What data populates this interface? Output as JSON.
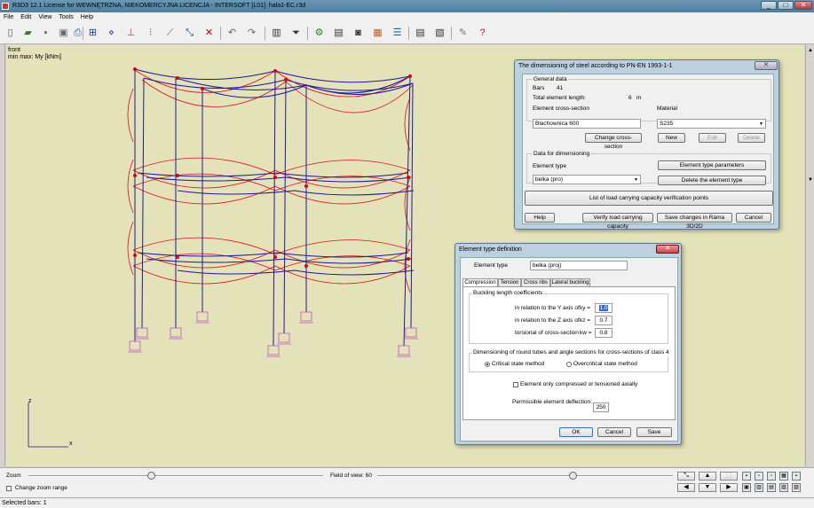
{
  "window": {
    "title": "R3D3 12.1 License for WEWNĘTRZNA, NIEKOMERCYJNA LICENCJA - INTERSOFT [L01]: hala1-EC.r3d",
    "minimize": "_",
    "maximize": "□",
    "close": "✕"
  },
  "menu": [
    "File",
    "Edit",
    "View",
    "Tools",
    "Help"
  ],
  "toolbar_icons": [
    "new-file-icon",
    "open-folder-icon",
    "save-icon",
    "save-as-icon",
    "print-preview-icon",
    "structure-icon",
    "nodes-icon",
    "supports-icon",
    "loads-icon",
    "bars-icon",
    "select-icon",
    "delete-icon",
    "undo-icon",
    "redo-icon",
    "table-icon",
    "filter-icon",
    "calculate-icon",
    "results-icon",
    "camera-icon",
    "grid-icon",
    "list-icon",
    "report-icon",
    "export-icon",
    "settings-icon",
    "help-icon"
  ],
  "viewport": {
    "view_name": "front",
    "view_info": "min max: My [kNm]",
    "axis_z": "z",
    "axis_x": "x",
    "colors": {
      "background": "#e3e2b9",
      "structure": "#1a1aa0",
      "diagram": "#e01010",
      "node": "#e00000",
      "support": "#c050c0"
    }
  },
  "bottom": {
    "zoom_label": "Zoom",
    "change_zoom_label": "Change zoom range",
    "field_of_view_label": "Field of view: 60"
  },
  "nav_buttons": [
    "⤡",
    "▲",
    "⬚",
    "◀",
    "▼",
    "▶"
  ],
  "status": "Selected bars: 1",
  "dialog1": {
    "title": "The dimensioning of steel according to PN-EN 1993-1-1",
    "close": "✕",
    "general_data": "General data",
    "bars_label": "Bars",
    "bars_value": "41",
    "total_length_label": "Total element length:",
    "total_length_value": "6",
    "total_length_unit": "m",
    "cross_section_label": "Element cross-section",
    "cross_section_value": "Blachownica 600",
    "change_cross_section": "Change cross-section",
    "material_label": "Material",
    "material_value": "S235",
    "new_btn": "New",
    "edit_btn": "Edit",
    "delete_btn": "Delete",
    "data_for_dim": "Data for dimensioning",
    "element_type_label": "Element type",
    "element_type_value": "belka (pro)",
    "element_type_params": "Element type parameters",
    "delete_element_type": "Delete the element type",
    "list_points": "List of load carrying capacity verification points",
    "help_btn": "Help",
    "verify_btn": "Verify load carrying capacity",
    "save_btn": "Save changes in Rama 3D/2D",
    "cancel_btn": "Cancel"
  },
  "dialog2": {
    "title": "Element type definition",
    "close": "✕",
    "element_type_label": "Element type",
    "element_type_value": "belka (proj)",
    "tabs": [
      "Compression",
      "Tension",
      "Cross ribs",
      "Lateral buckling"
    ],
    "buckling_title": "Buckling length coefficients",
    "ky_label": "in relation to the Y axis of",
    "ky_sym": "ky =",
    "ky_value": "1.0",
    "kz_label": "in relation to the Z axis of",
    "kz_sym": "kz =",
    "kz_value": "0.7",
    "kw_label": "torsional of cross-section",
    "kw_sym": "kw =",
    "kw_value": "0.8",
    "round_title": "Dimensioning of round tubes and angle sections for cross-sections of class 4",
    "radio1": "Critical state method",
    "radio2": "Overcritical state method",
    "only_compressed": "Element only compressed or tensioned axially",
    "deflection_label": "Permissible element deflection:",
    "deflection_value": "250",
    "ok": "OK",
    "cancel": "Cancel",
    "save": "Save"
  }
}
